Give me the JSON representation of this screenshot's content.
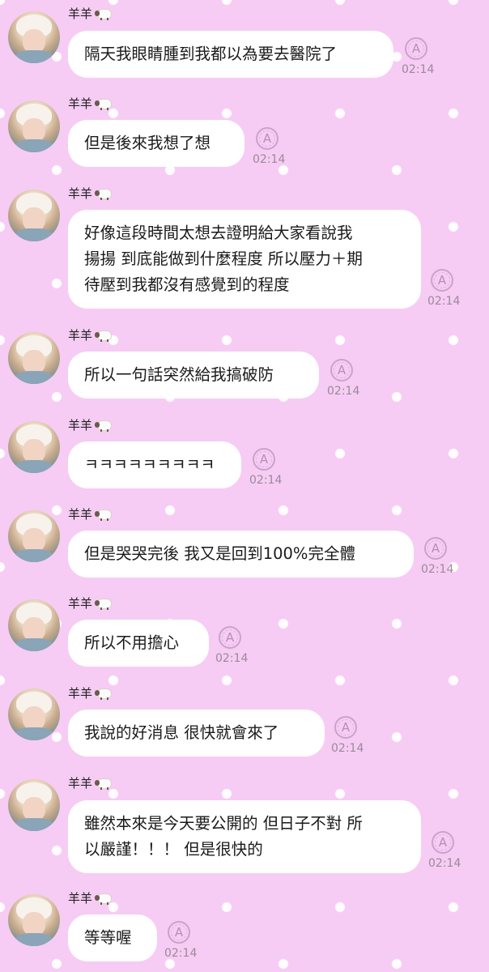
{
  "sender_name": "羊羊",
  "sender_icon": "sheep-icon",
  "status_icon": "auto-translate-icon",
  "colors": {
    "background": "#f6ccf4",
    "bubble": "#ffffff",
    "time_text": "#9a8a99"
  },
  "messages": [
    {
      "text": "隔天我眼睛腫到我都以為要去醫院了",
      "time": "02:14"
    },
    {
      "text": "但是後來我想了想",
      "time": "02:14"
    },
    {
      "text": "好像這段時間太想去證明給大家看說我\n揚揚 到底能做到什麼程度 所以壓力＋期\n待壓到我都沒有感覺到的程度",
      "time": "02:14"
    },
    {
      "text": "所以一句話突然給我搞破防",
      "time": "02:14"
    },
    {
      "text": "ㅋㅋㅋㅋㅋㅋㅋㅋㅋ",
      "time": "02:14"
    },
    {
      "text": "但是哭哭完後 我又是回到100%完全體",
      "time": "02:14"
    },
    {
      "text": "所以不用擔心",
      "time": "02:14"
    },
    {
      "text": "我說的好消息 很快就會來了",
      "time": "02:14"
    },
    {
      "text": "雖然本來是今天要公開的 但日子不對 所\n以嚴謹！！！  但是很快的",
      "time": "02:14"
    },
    {
      "text": "等等喔",
      "time": "02:14"
    }
  ]
}
